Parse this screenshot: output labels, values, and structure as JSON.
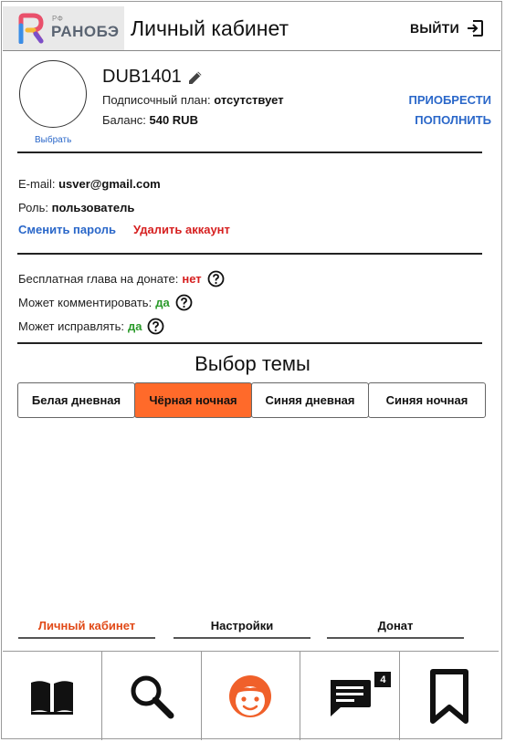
{
  "header": {
    "logo_rf": "РФ",
    "logo_text": "РАНОБЭ",
    "title": "Личный кабинет",
    "logout_label": "ВЫЙТИ"
  },
  "profile": {
    "avatar_choose": "Выбрать",
    "username": "DUB1401",
    "plan_label": "Подписочный план: ",
    "plan_value": "отсутствует",
    "balance_label": "Баланс: ",
    "balance_value": "540 RUB",
    "buy_label": "ПРИОБРЕСТИ",
    "topup_label": "ПОПОЛНИТЬ"
  },
  "account": {
    "email_label": "E-mail: ",
    "email_value": "usver@gmail.com",
    "role_label": "Роль: ",
    "role_value": "пользователь",
    "change_password": "Сменить пароль",
    "delete_account": "Удалить аккаунт"
  },
  "permissions": [
    {
      "label": "Бесплатная глава на донате: ",
      "value": "нет",
      "color": "#d61f1f"
    },
    {
      "label": "Может комментировать: ",
      "value": "да",
      "color": "#2a9a2a"
    },
    {
      "label": "Может исправлять: ",
      "value": "да",
      "color": "#2a9a2a"
    }
  ],
  "theme": {
    "title": "Выбор темы",
    "options": [
      "Белая дневная",
      "Чёрная ночная",
      "Синяя дневная",
      "Синяя ночная"
    ],
    "selected": "Чёрная ночная",
    "accent_color": "#ff6a2a"
  },
  "profile_tabs": {
    "items": [
      "Личный кабинет",
      "Настройки",
      "Донат"
    ],
    "active": "Личный кабинет"
  },
  "bottom_nav": {
    "items": [
      {
        "icon": "book-icon"
      },
      {
        "icon": "search-icon"
      },
      {
        "icon": "profile-face-icon"
      },
      {
        "icon": "chat-icon",
        "badge": "4"
      },
      {
        "icon": "bookmark-icon"
      }
    ]
  },
  "colors": {
    "link": "#2a67c9",
    "danger": "#d61f1f",
    "success": "#2a9a2a",
    "active_tab": "#e14a18"
  }
}
